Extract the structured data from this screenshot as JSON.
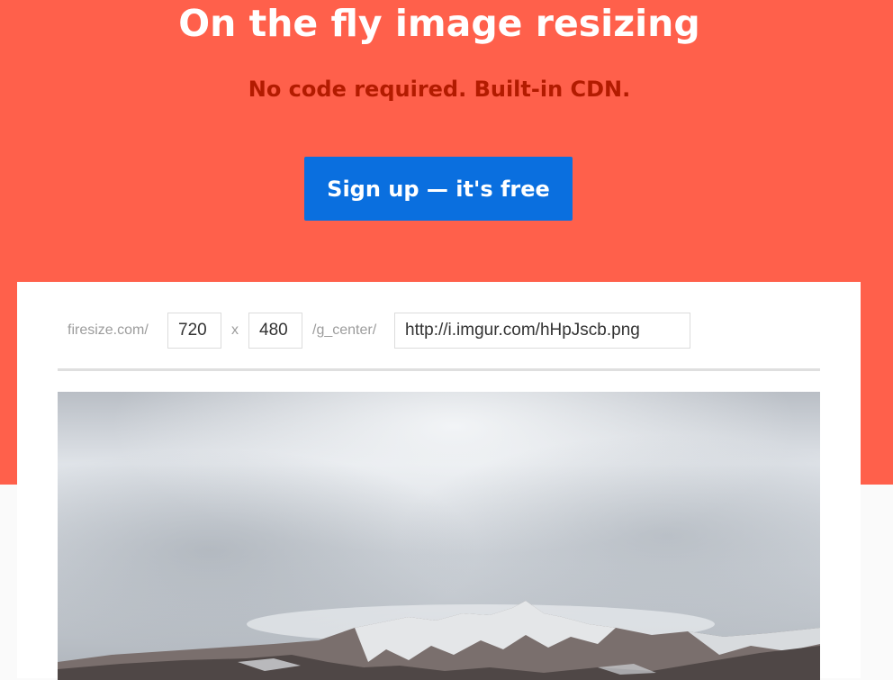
{
  "hero": {
    "title": "On the fly image resizing",
    "subtitle": "No code required. Built-in CDN.",
    "signup_label": "Sign up — it's free"
  },
  "demo": {
    "prefix": "firesize.com/",
    "width_value": "720",
    "separator": "x",
    "height_value": "480",
    "gravity": "/g_center/",
    "source_url": "http://i.imgur.com/hHpJscb.png"
  },
  "colors": {
    "hero_bg": "#ff604b",
    "subtitle": "#b31b00",
    "signup_bg": "#0a6fdf"
  }
}
